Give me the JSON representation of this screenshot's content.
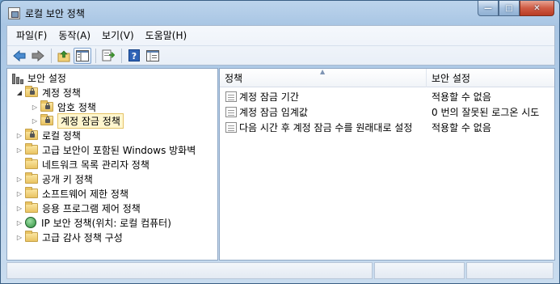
{
  "window": {
    "title": "로컬 보안 정책"
  },
  "caption_buttons": {
    "minimize": "—",
    "maximize": "□",
    "close": "✕"
  },
  "menu": [
    {
      "label": "파일(F)"
    },
    {
      "label": "동작(A)"
    },
    {
      "label": "보기(V)"
    },
    {
      "label": "도움말(H)"
    }
  ],
  "toolbar": {
    "buttons": [
      "back-icon",
      "forward-icon",
      "up-folder-icon",
      "show-hide-tree-icon",
      "export-list-icon",
      "help-icon",
      "properties-icon"
    ]
  },
  "tree": {
    "root": "보안 설정",
    "items": [
      {
        "label": "계정 정책"
      },
      {
        "label": "암호 정책"
      },
      {
        "label": "계정 잠금 정책"
      },
      {
        "label": "로컬 정책"
      },
      {
        "label": "고급 보안이 포함된 Windows 방화벽"
      },
      {
        "label": "네트워크 목록 관리자 정책"
      },
      {
        "label": "공개 키 정책"
      },
      {
        "label": "소프트웨어 제한 정책"
      },
      {
        "label": "응용 프로그램 제어 정책"
      },
      {
        "label": "IP 보안 정책(위치: 로컬 컴퓨터)"
      },
      {
        "label": "고급 감사 정책 구성"
      }
    ]
  },
  "list": {
    "columns": [
      "정책",
      "보안 설정"
    ],
    "rows": [
      {
        "policy": "계정 잠금 기간",
        "setting": "적용할 수 없음"
      },
      {
        "policy": "계정 잠금 임계값",
        "setting": "0 번의 잘못된 로그온 시도"
      },
      {
        "policy": "다음 시간 후 계정 잠금 수를 원래대로 설정",
        "setting": "적용할 수 없음"
      }
    ]
  },
  "colors": {
    "accent": "#3a6ea5",
    "selection": "#fff6cf"
  }
}
